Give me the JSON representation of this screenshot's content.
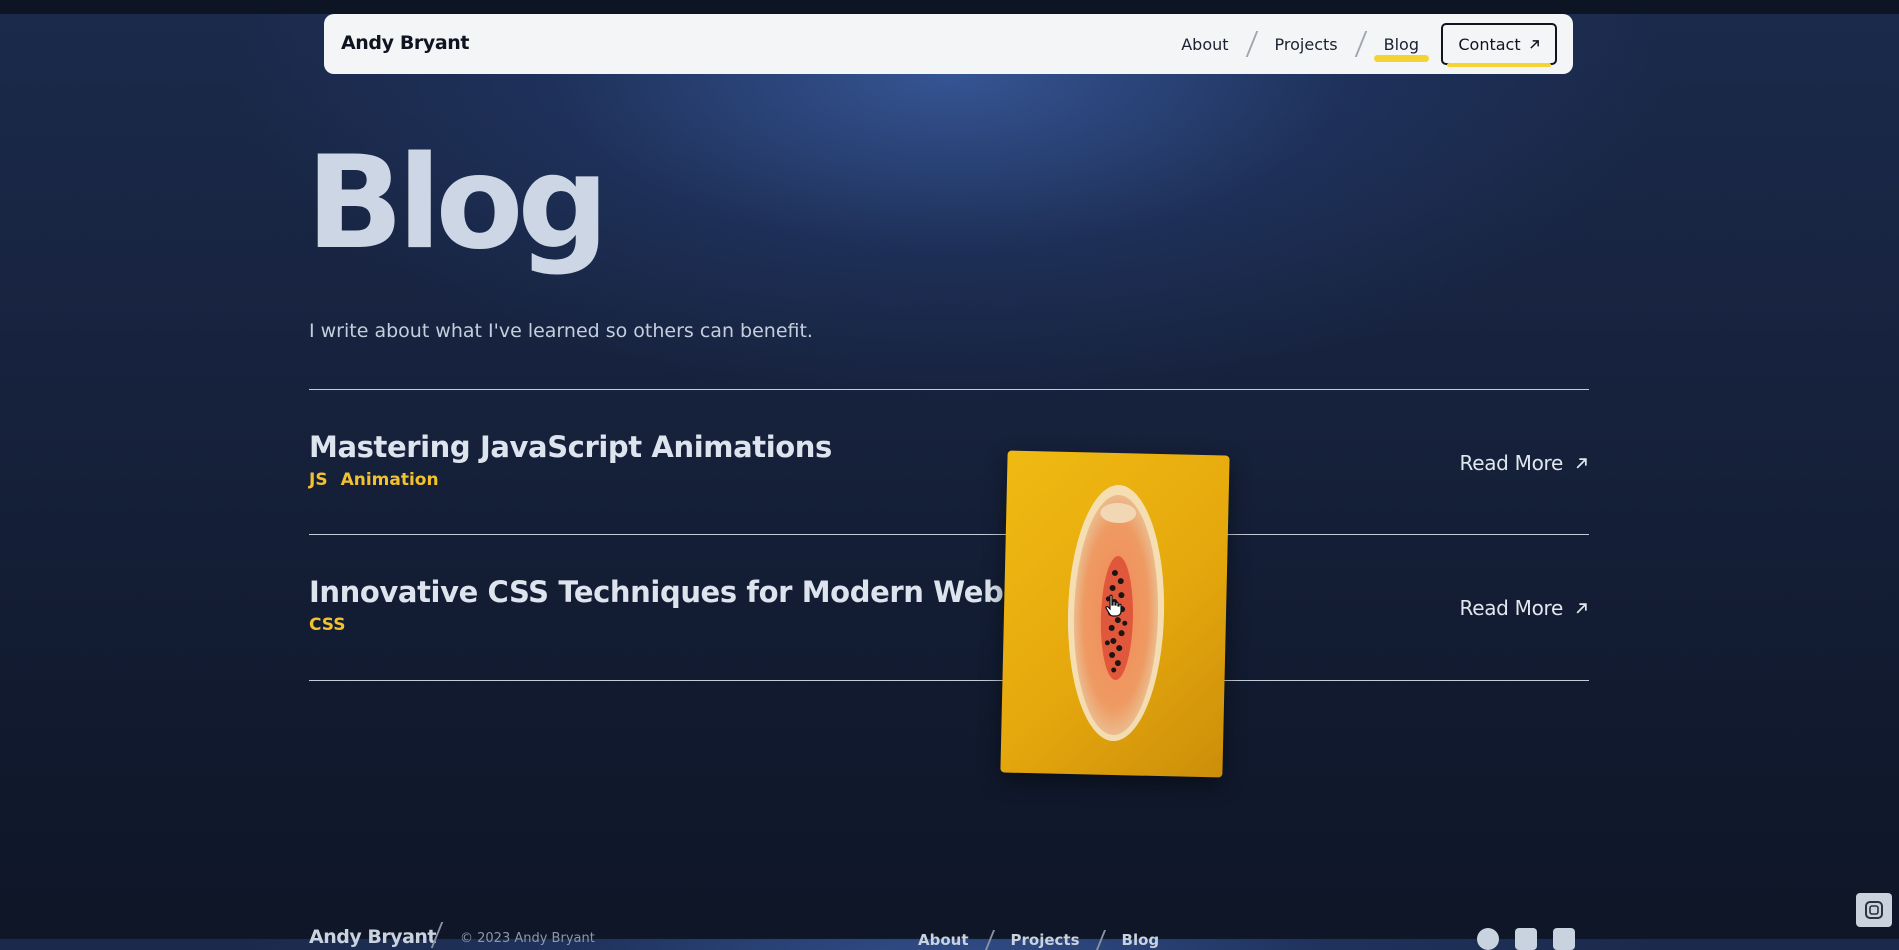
{
  "header": {
    "logo": "Andy Bryant",
    "nav": [
      {
        "label": "About"
      },
      {
        "label": "Projects"
      },
      {
        "label": "Blog",
        "active": true
      }
    ],
    "contact_label": "Contact",
    "contact_icon": "arrow-up-right-icon"
  },
  "hero": {
    "title": "Blog",
    "subtitle": "I write about what I've learned so others can benefit."
  },
  "posts": [
    {
      "title": "Mastering JavaScript Animations",
      "tags": [
        "JS",
        "Animation"
      ],
      "link_label": "Read More"
    },
    {
      "title": "Innovative CSS Techniques for Modern Web Design",
      "tags": [
        "CSS"
      ],
      "link_label": "Read More"
    }
  ],
  "hover_image": {
    "icon": "papaya-photo"
  },
  "footer": {
    "name": "Andy Bryant",
    "copyright": "© 2023 Andy Bryant",
    "nav": [
      "About",
      "Projects",
      "Blog"
    ],
    "socials": [
      "github-icon",
      "twitter-icon",
      "linkedin-icon"
    ]
  },
  "colors": {
    "accent_yellow": "#f5d332",
    "tag_yellow": "#f2c12e",
    "background_navy": "#16213b",
    "header_bg": "#f3f5f7"
  }
}
